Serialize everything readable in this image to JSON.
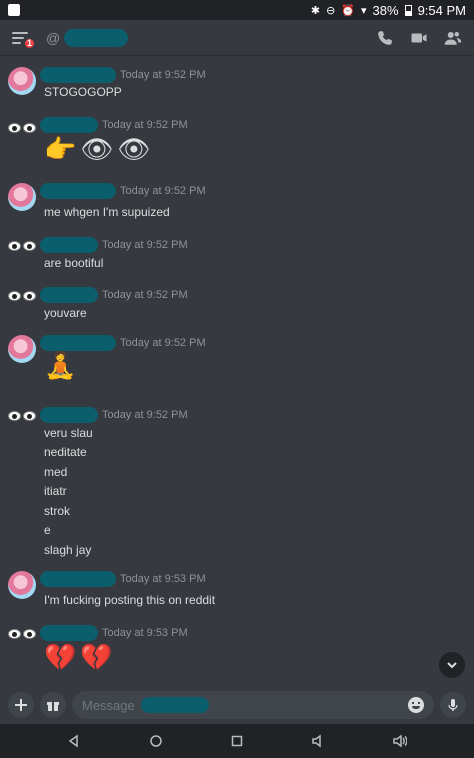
{
  "statusbar": {
    "battery": "38%",
    "time": "9:54 PM"
  },
  "header": {
    "badge_count": "1",
    "at_symbol": "@"
  },
  "composer": {
    "placeholder": "Message"
  },
  "messages": [
    {
      "avatar": "pink-character",
      "time": "Today at 9:52 PM",
      "lines": [
        "STOGOGOPP"
      ]
    },
    {
      "avatar": "eyes",
      "time": "Today at 9:52 PM",
      "emoji": [
        "👉",
        "👁",
        "👁"
      ]
    },
    {
      "avatar": "pink-character",
      "time": "Today at 9:52 PM",
      "lines": [
        "me whgen I'm supuized"
      ]
    },
    {
      "avatar": "eyes",
      "time": "Today at 9:52 PM",
      "lines": [
        "are bootiful"
      ]
    },
    {
      "avatar": "eyes",
      "time": "Today at 9:52 PM",
      "lines": [
        "youvare"
      ]
    },
    {
      "avatar": "pink-character",
      "time": "Today at 9:52 PM",
      "emoji": [
        "🧘"
      ]
    },
    {
      "avatar": "eyes",
      "time": "Today at 9:52 PM",
      "lines": [
        "veru slau",
        "neditate",
        "med",
        "itiatr",
        "strok",
        "e",
        "slagh jay"
      ]
    },
    {
      "avatar": "pink-character",
      "time": "Today at 9:53 PM",
      "lines": [
        "I'm fucking posting this on reddit"
      ]
    },
    {
      "avatar": "eyes",
      "time": "Today at 9:53 PM",
      "emoji": [
        "💔",
        "💔"
      ]
    }
  ]
}
